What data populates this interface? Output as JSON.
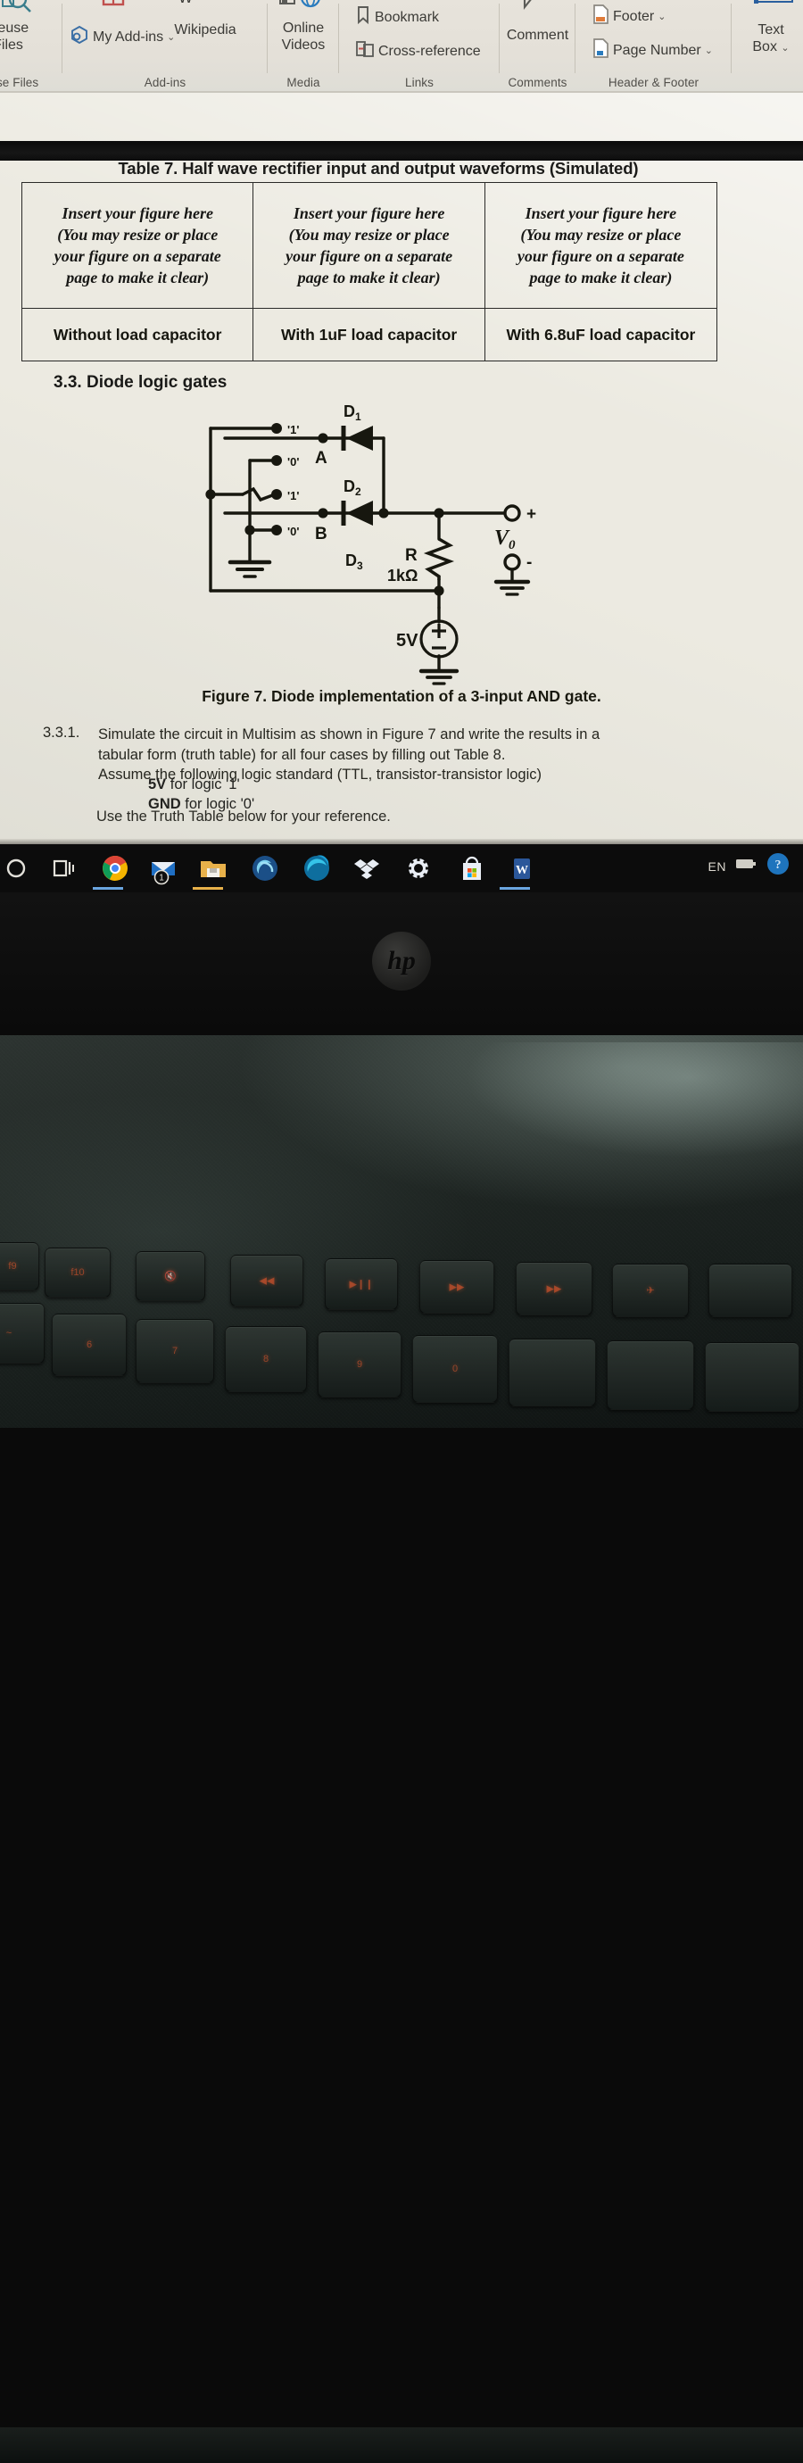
{
  "ribbon": {
    "groups": [
      {
        "label": "euse Files",
        "name": "reuse-files"
      },
      {
        "label": "Add-ins",
        "name": "add-ins"
      },
      {
        "label": "Media",
        "name": "media"
      },
      {
        "label": "Links",
        "name": "links"
      },
      {
        "label": "Comments",
        "name": "comments"
      },
      {
        "label": "Header & Footer",
        "name": "header-footer"
      },
      {
        "label": "",
        "name": "text"
      }
    ],
    "reuse_files_line1": "Reuse",
    "reuse_files_line2": "Files",
    "my_addins": "My Add-ins",
    "wikipedia": "Wikipedia",
    "online_line1": "Online",
    "online_line2": "Videos",
    "bookmark": "Bookmark",
    "cross_reference": "Cross-reference",
    "comment": "Comment",
    "footer": "Footer",
    "page_number": "Page Number",
    "text_box_line1": "Text",
    "text_box_line2": "Box",
    "chevron": "⌄"
  },
  "document": {
    "table7": {
      "title": "Table 7. Half wave rectifier input and output waveforms (Simulated)",
      "placeholder_lines": [
        "Insert your figure here",
        "(You may resize or place",
        "your figure on a separate",
        "page to make it clear)"
      ],
      "captions": [
        "Without load capacitor",
        "With 1uF load capacitor",
        "With 6.8uF load capacitor"
      ]
    },
    "heading_33": "3.3.  Diode logic gates",
    "figure_caption": "Figure 7. Diode implementation of a 3-input AND gate.",
    "task": {
      "number": "3.3.1.",
      "line1": "Simulate the circuit in Multisim as shown in Figure 7 and write the results in a",
      "line2": "tabular form (truth table) for all four cases by filling out Table 8.",
      "line3": "Assume the following logic standard (TTL, transistor-transistor logic)",
      "logic1_bold": "5V",
      "logic1_rest": " for logic '1'",
      "logic0_bold": "GND",
      "logic0_rest": " for logic '0'",
      "last_line": "Use the Truth Table below for your reference."
    },
    "circuit": {
      "label_A": "A",
      "label_B": "B",
      "label_D1": "D",
      "label_D1_sub": "1",
      "label_D2": "D",
      "label_D2_sub": "2",
      "label_D3": "D",
      "label_D3_sub": "3",
      "sw_high_1": "'1'",
      "sw_low_1": "'0'",
      "sw_high_2": "'1'",
      "sw_low_2": "'0'",
      "resistor_name": "R",
      "resistor_value": "1kΩ",
      "source_value": "5V",
      "source_plus": "+",
      "source_minus": "−",
      "out_name": "V",
      "out_sub": "0",
      "out_plus": "+",
      "out_minus": "-"
    }
  },
  "taskbar": {
    "icons": [
      {
        "name": "search-icon",
        "glyph": "O"
      },
      {
        "name": "task-view-icon",
        "glyph": "❑"
      },
      {
        "name": "chrome-icon",
        "glyph": ""
      },
      {
        "name": "mail-icon",
        "glyph": "",
        "badge": "1"
      },
      {
        "name": "file-explorer-icon",
        "glyph": ""
      },
      {
        "name": "edge-dev-icon",
        "glyph": ""
      },
      {
        "name": "edge-icon",
        "glyph": ""
      },
      {
        "name": "dropbox-icon",
        "glyph": ""
      },
      {
        "name": "settings-gear-icon",
        "glyph": ""
      },
      {
        "name": "microsoft-store-icon",
        "glyph": ""
      },
      {
        "name": "word-icon",
        "glyph": "W"
      }
    ],
    "language": "EN"
  },
  "laptop": {
    "brand": "hp"
  },
  "colors": {
    "ribbon_bg": "#e4e0d8",
    "page_bg": "#eceae1",
    "ink": "#1b1b19",
    "taskbar_bg": "#0c0c0c",
    "word_blue": "#2b579a",
    "accent_orange": "#eb5a2d"
  }
}
